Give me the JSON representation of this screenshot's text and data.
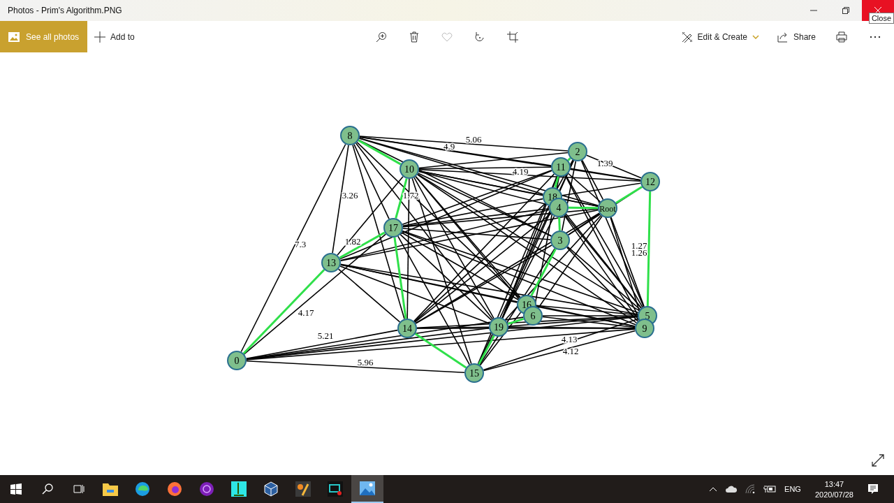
{
  "window": {
    "title": "Photos - Prim's Algorithm.PNG",
    "tooltip": "Close"
  },
  "toolbar": {
    "left": [
      {
        "kind": "gallery",
        "label": "See all photos"
      },
      {
        "kind": "add",
        "label": "Add to"
      }
    ],
    "center": [
      {
        "kind": "zoom"
      },
      {
        "kind": "delete"
      },
      {
        "kind": "favorite",
        "disabled": true
      },
      {
        "kind": "rotate"
      },
      {
        "kind": "crop"
      }
    ],
    "right": [
      {
        "kind": "edit",
        "label": "Edit & Create"
      },
      {
        "kind": "share",
        "label": "Share"
      },
      {
        "kind": "print"
      },
      {
        "kind": "more"
      }
    ]
  },
  "graph": {
    "nodes": [
      "8",
      "2",
      "10",
      "11",
      "12",
      "18",
      "4",
      "Root",
      "17",
      "3",
      "13",
      "16",
      "6",
      "14",
      "19",
      "5",
      "9",
      "0",
      "15"
    ],
    "weights": [
      "5.06",
      "4.9",
      "3.26",
      "7.3",
      "5.96",
      "4.17",
      "1.82",
      "1.72",
      "1.27",
      "1.26",
      "1.39",
      "4.13",
      "4.12",
      "4.19",
      "5.21"
    ]
  },
  "taskbar": {
    "apps": [
      {
        "kind": "explorer",
        "selected": false
      },
      {
        "kind": "edge",
        "selected": false
      },
      {
        "kind": "firefox",
        "selected": false
      },
      {
        "kind": "tor",
        "selected": false
      },
      {
        "kind": "game",
        "selected": false
      },
      {
        "kind": "virtualbox",
        "selected": false
      },
      {
        "kind": "matlab",
        "selected": false
      },
      {
        "kind": "recorder",
        "selected": false
      },
      {
        "kind": "photos",
        "selected": true
      }
    ],
    "language": "ENG",
    "time": "13:47",
    "date": "2020/07/28"
  }
}
